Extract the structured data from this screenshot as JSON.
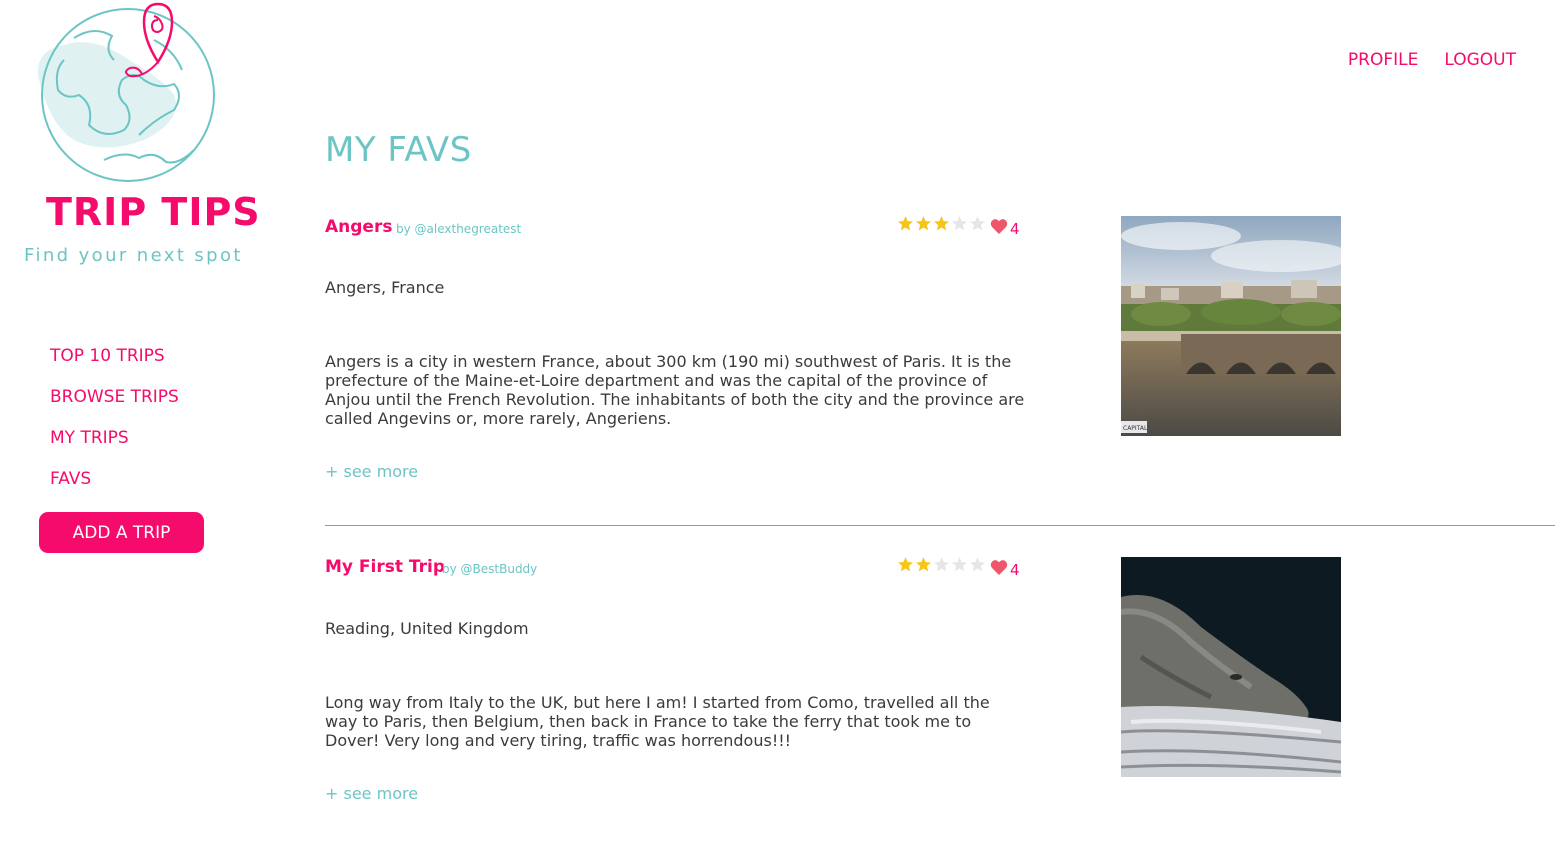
{
  "brand": {
    "name": "TRIP TIPS",
    "tagline": "Find your next spot",
    "colors": {
      "primary": "#f50b6b",
      "accent": "#6cc5c4"
    }
  },
  "header": {
    "profile_label": "PROFILE",
    "logout_label": "LOGOUT"
  },
  "sidebar": {
    "items": [
      {
        "label": "TOP 10 TRIPS"
      },
      {
        "label": "BROWSE TRIPS"
      },
      {
        "label": "MY TRIPS"
      },
      {
        "label": "FAVS"
      }
    ],
    "add_trip_label": "ADD A TRIP"
  },
  "main": {
    "title": "MY FAVS",
    "trips": [
      {
        "title": "Angers",
        "author": "by @alexthegreatest",
        "rating": 3,
        "rating_max": 5,
        "likes": "4",
        "location": "Angers, France",
        "description": "Angers is a city in western France, about 300 km (190 mi) southwest of Paris. It is the prefecture of the Maine-et-Loire department and was the capital of the province of Anjou until the French Revolution. The inhabitants of both the city and the province are called Angevins or, more rarely, Angeriens.",
        "see_more": "+ see more",
        "photo_icon": "city-river-bridge-photo"
      },
      {
        "title": "My First Trip",
        "author": "by @BestBuddy",
        "rating": 2,
        "rating_max": 5,
        "likes": "4",
        "location": "Reading, United Kingdom",
        "description": "Long way from Italy to the UK, but here I am! I started from Como, travelled all the way to Paris, then Belgium, then back in France to take the ferry that took me to Dover! Very long and very tiring, traffic was horrendous!!!",
        "see_more": "+ see more",
        "photo_icon": "sleeping-dog-photo"
      }
    ]
  }
}
